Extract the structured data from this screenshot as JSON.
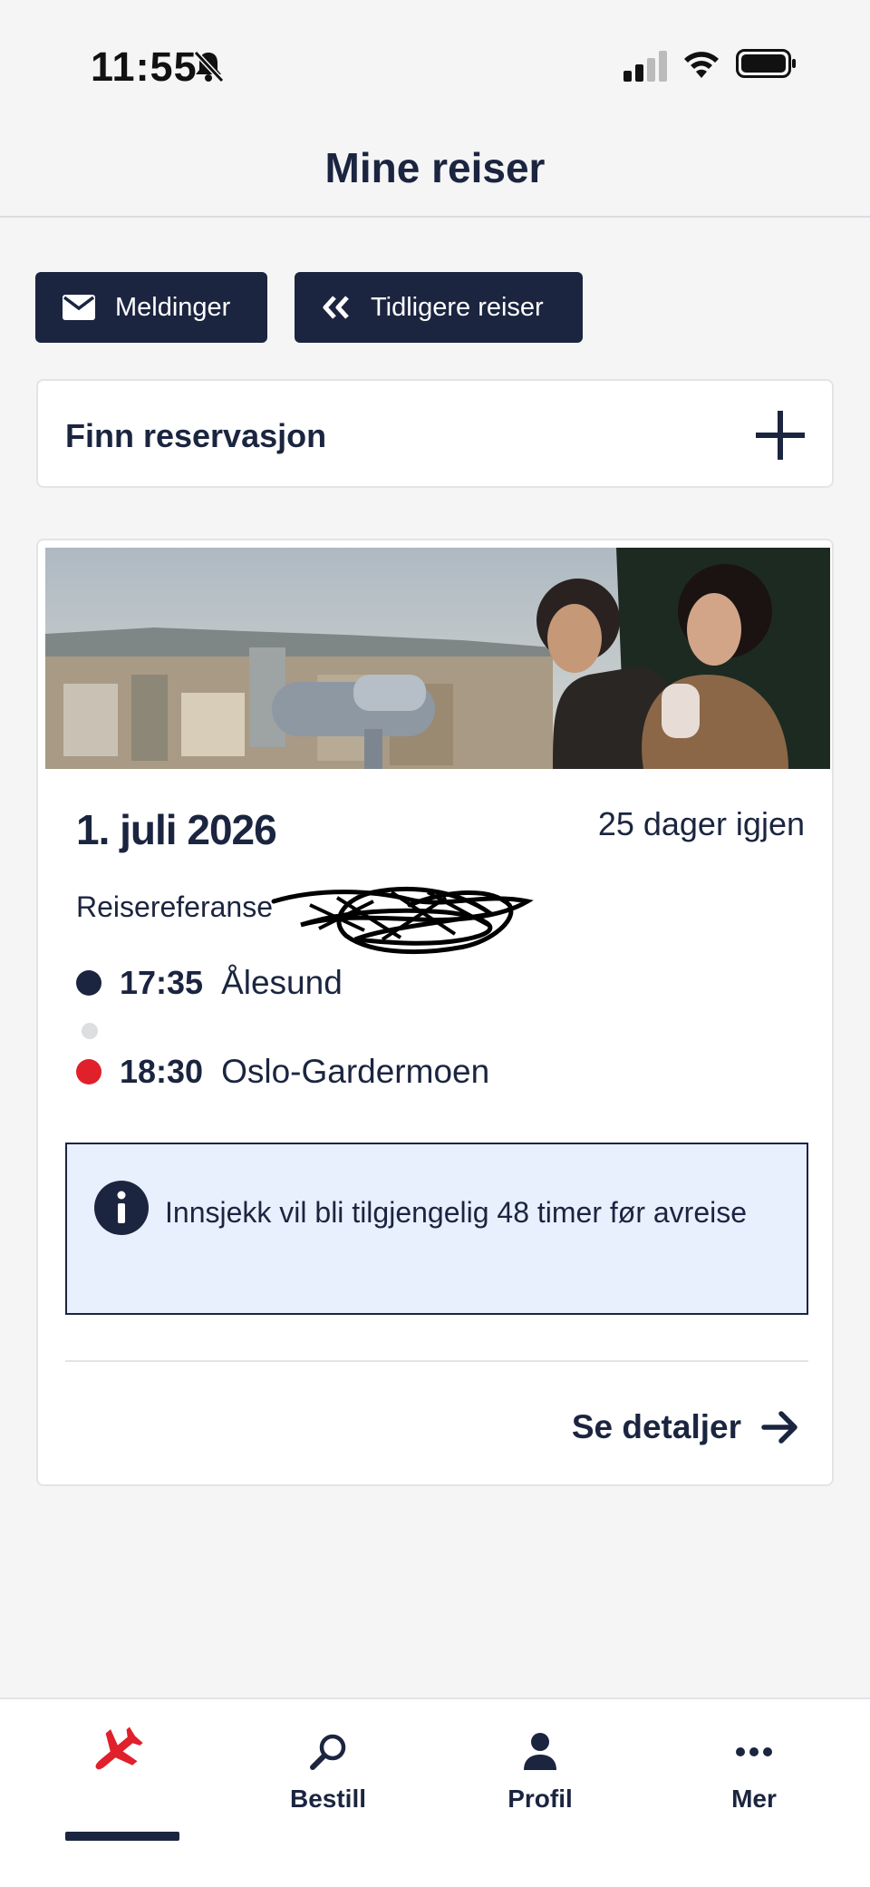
{
  "status_bar": {
    "time": "11:55",
    "icons": [
      "bell-off-icon",
      "signal-icon",
      "wifi-icon",
      "battery-icon"
    ]
  },
  "header": {
    "title": "Mine reiser"
  },
  "actions": {
    "messages_label": "Meldinger",
    "messages_icon": "envelope-icon",
    "previous_label": "Tidligere reiser",
    "previous_icon": "double-chevron-left-icon"
  },
  "find_reservation": {
    "label": "Finn reservasjon",
    "icon": "plus-icon"
  },
  "trip": {
    "date": "1. juli 2026",
    "days_left": "25 dager igjen",
    "reference_label": "Reisereferanse",
    "departure": {
      "time": "17:35",
      "place": "Ålesund"
    },
    "arrival": {
      "time": "18:30",
      "place": "Oslo-Gardermoen"
    },
    "info": "Innsjekk vil bli tilgjengelig 48 timer før avreise",
    "details_label": "Se detaljer"
  },
  "tabs": [
    {
      "label": "",
      "icon": "airplane-icon",
      "active": true
    },
    {
      "label": "Bestill",
      "icon": "search-icon"
    },
    {
      "label": "Profil",
      "icon": "person-icon"
    },
    {
      "label": "Mer",
      "icon": "more-dots-icon"
    }
  ],
  "colors": {
    "navy": "#1b2540",
    "red": "#e0202b",
    "info_bg": "#e8f0fd",
    "page_bg": "#f5f5f6"
  }
}
